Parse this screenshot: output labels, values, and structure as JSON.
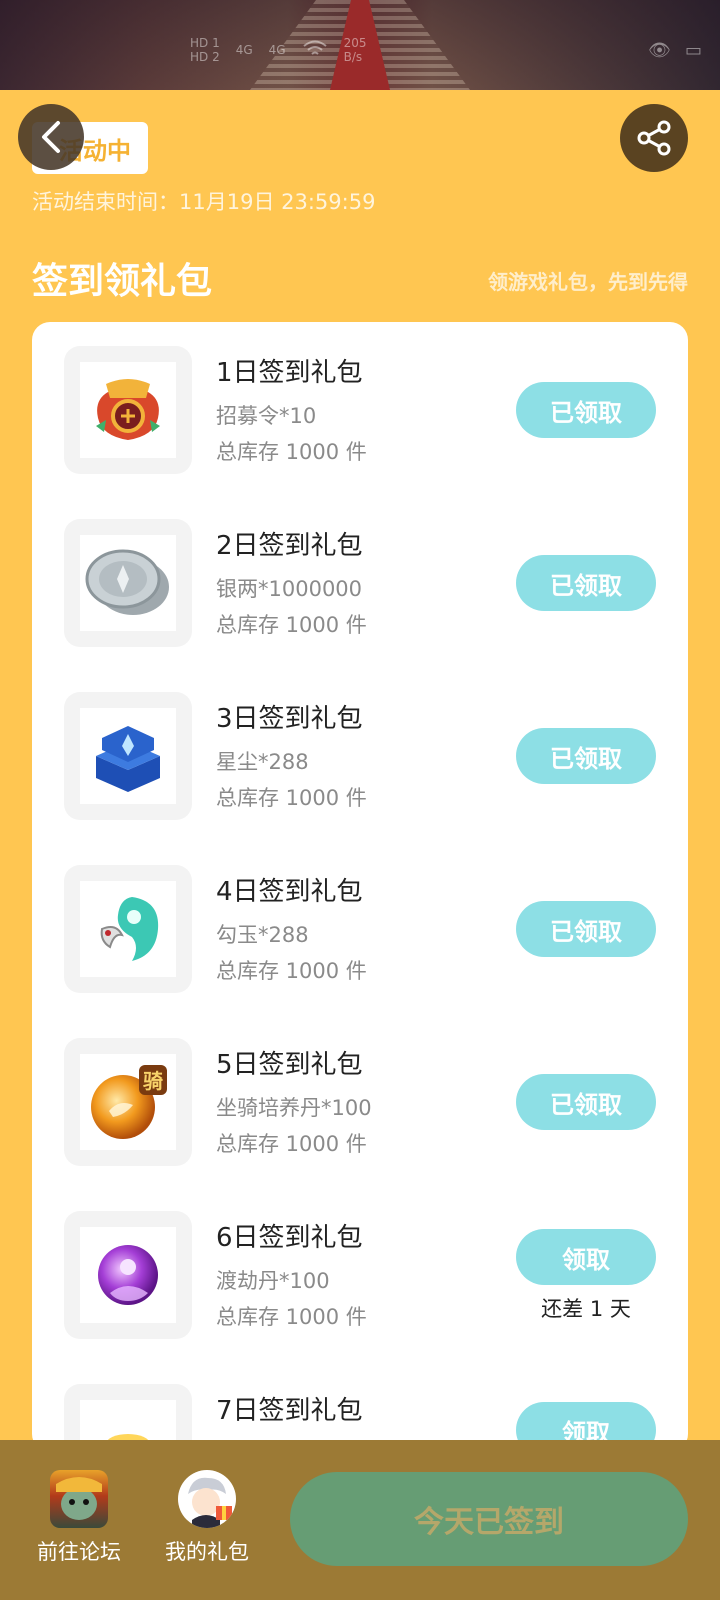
{
  "status_bar": {
    "hd1": "HD 1",
    "hd2": "HD 2",
    "net1": "4G",
    "net2": "4G",
    "speed_value": "205",
    "speed_unit": "B/s"
  },
  "header": {
    "badge": "活动中",
    "end_time": "活动结束时间：11月19日 23:59:59",
    "section_title": "签到领礼包",
    "section_subtitle": "领游戏礼包，先到先得"
  },
  "items": [
    {
      "title": "1日签到礼包",
      "desc": "招募令*10",
      "stock": "总库存 1000 件",
      "button": "已领取",
      "icon": "recruit-token-icon"
    },
    {
      "title": "2日签到礼包",
      "desc": "银两*1000000",
      "stock": "总库存 1000 件",
      "button": "已领取",
      "icon": "silver-coin-icon"
    },
    {
      "title": "3日签到礼包",
      "desc": "星尘*288",
      "stock": "总库存 1000 件",
      "button": "已领取",
      "icon": "stardust-chest-icon"
    },
    {
      "title": "4日签到礼包",
      "desc": "勾玉*288",
      "stock": "总库存 1000 件",
      "button": "已领取",
      "icon": "magatama-icon"
    },
    {
      "title": "5日签到礼包",
      "desc": "坐骑培养丹*100",
      "stock": "总库存 1000 件",
      "button": "已领取",
      "icon": "mount-pill-icon",
      "icon_text": "骑"
    },
    {
      "title": "6日签到礼包",
      "desc": "渡劫丹*100",
      "stock": "总库存 1000 件",
      "button": "领取",
      "icon": "tribulation-pill-icon",
      "remain": "还差 1 天"
    },
    {
      "title": "7日签到礼包",
      "desc": "",
      "stock": "",
      "button": "领取",
      "icon": "gold-ingot-icon"
    }
  ],
  "bottom_bar": {
    "forum_label": "前往论坛",
    "gifts_label": "我的礼包",
    "signed_button": "今天已签到"
  },
  "colors": {
    "background": "#FFC651",
    "claim_button": "#8DDFE5",
    "bottom_bar": "#9C7A35",
    "signed_button": "#669D74"
  }
}
